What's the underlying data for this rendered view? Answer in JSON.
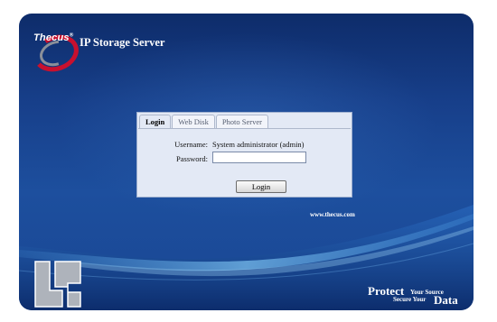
{
  "header": {
    "brand": "Thecus",
    "brand_mark": "®",
    "product_title": "IP Storage Server"
  },
  "login": {
    "tabs": [
      {
        "label": "Login",
        "active": true
      },
      {
        "label": "Web Disk",
        "active": false
      },
      {
        "label": "Photo Server",
        "active": false
      }
    ],
    "username_label": "Username:",
    "username_value": "System administrator (admin)",
    "password_label": "Password:",
    "password_value": "",
    "submit_label": "Login"
  },
  "footer": {
    "website": "www.thecus.com",
    "tagline": {
      "protect": "Protect",
      "your_source": "Your Source",
      "secure_your": "Secure Your",
      "data": "Data"
    }
  },
  "colors": {
    "frame_dark": "#0e2c6a",
    "frame_mid": "#1d4f9e",
    "panel": "#e3e9f5",
    "logo_red": "#c8102e",
    "watermark_gray": "#aeb3bb"
  },
  "icons": {
    "brand_logo": "thecus-swirl-logo",
    "watermark": "legit-reviews-logo"
  }
}
